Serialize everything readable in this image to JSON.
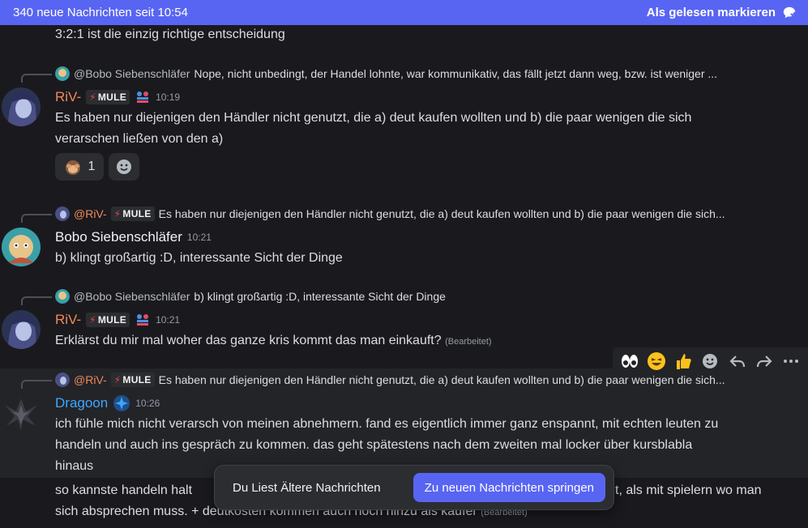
{
  "banner": {
    "count_text": "340 neue Nachrichten seit 10:54",
    "mark_read_label": "Als gelesen markieren"
  },
  "top_message": {
    "text": "3:2:1 ist die einzig richtige entscheidung"
  },
  "msg1": {
    "reply": {
      "name": "@Bobo Siebenschläfer",
      "text": "Nope, nicht unbedingt, der Handel lohnte, war kommunikativ, das fällt jetzt dann weg, bzw. ist weniger ..."
    },
    "username": "RiV-",
    "tag": "MULE",
    "time": "10:19",
    "lines": [
      "Es haben nur diejenigen den Händler nicht genutzt, die a) deut kaufen wollten und b) die paar wenigen die sich",
      "verarschen ließen von den a)"
    ],
    "reaction_count": "1"
  },
  "msg2": {
    "reply": {
      "name": "@RiV-",
      "tag": "MULE",
      "text": "Es haben nur diejenigen den Händler nicht genutzt, die a) deut kaufen wollten und b) die paar wenigen die sich..."
    },
    "username": "Bobo Siebenschläfer",
    "time": "10:21",
    "text": "b) klingt großartig :D, interessante Sicht der Dinge"
  },
  "msg3": {
    "reply": {
      "name": "@Bobo Siebenschläfer",
      "text": "b) klingt großartig :D, interessante Sicht der Dinge"
    },
    "username": "RiV-",
    "tag": "MULE",
    "time": "10:21",
    "text": "Erklärst du mir mal woher das ganze kris kommt das man einkauft?",
    "edited": "(Bearbeitet)"
  },
  "msg4": {
    "reply": {
      "name": "@RiV-",
      "tag": "MULE",
      "text": "Es haben nur diejenigen den Händler nicht genutzt, die a) deut kaufen wollten und b) die paar wenigen die sich..."
    },
    "username": "Dragoon",
    "time": "10:26",
    "lines": [
      "ich fühle mich nicht verarsch von meinen abnehmern. fand es eigentlich immer ganz enspannt, mit echten leuten zu",
      "handeln und auch ins gespräch zu kommen. das geht spätestens nach dem zweiten mal locker über kursblabla",
      "hinaus"
    ]
  },
  "msg5": {
    "line1_left": "so kannste handeln halt",
    "line1_right": "t, als mit spielern wo man",
    "line2": "sich absprechen muss. + deutkosten kommen auch noch hinzu als käufer",
    "edited": "(Bearbeitet)"
  },
  "popup": {
    "older_label": "Du Liest Ältere Nachrichten",
    "jump_label": "Zu neuen Nachrichten springen"
  },
  "toolbar_icons": [
    "eyes-emoji",
    "laughing-emoji",
    "thumbs-up-emoji",
    "add-reaction-icon",
    "reply-icon",
    "forward-icon",
    "more-icon"
  ]
}
